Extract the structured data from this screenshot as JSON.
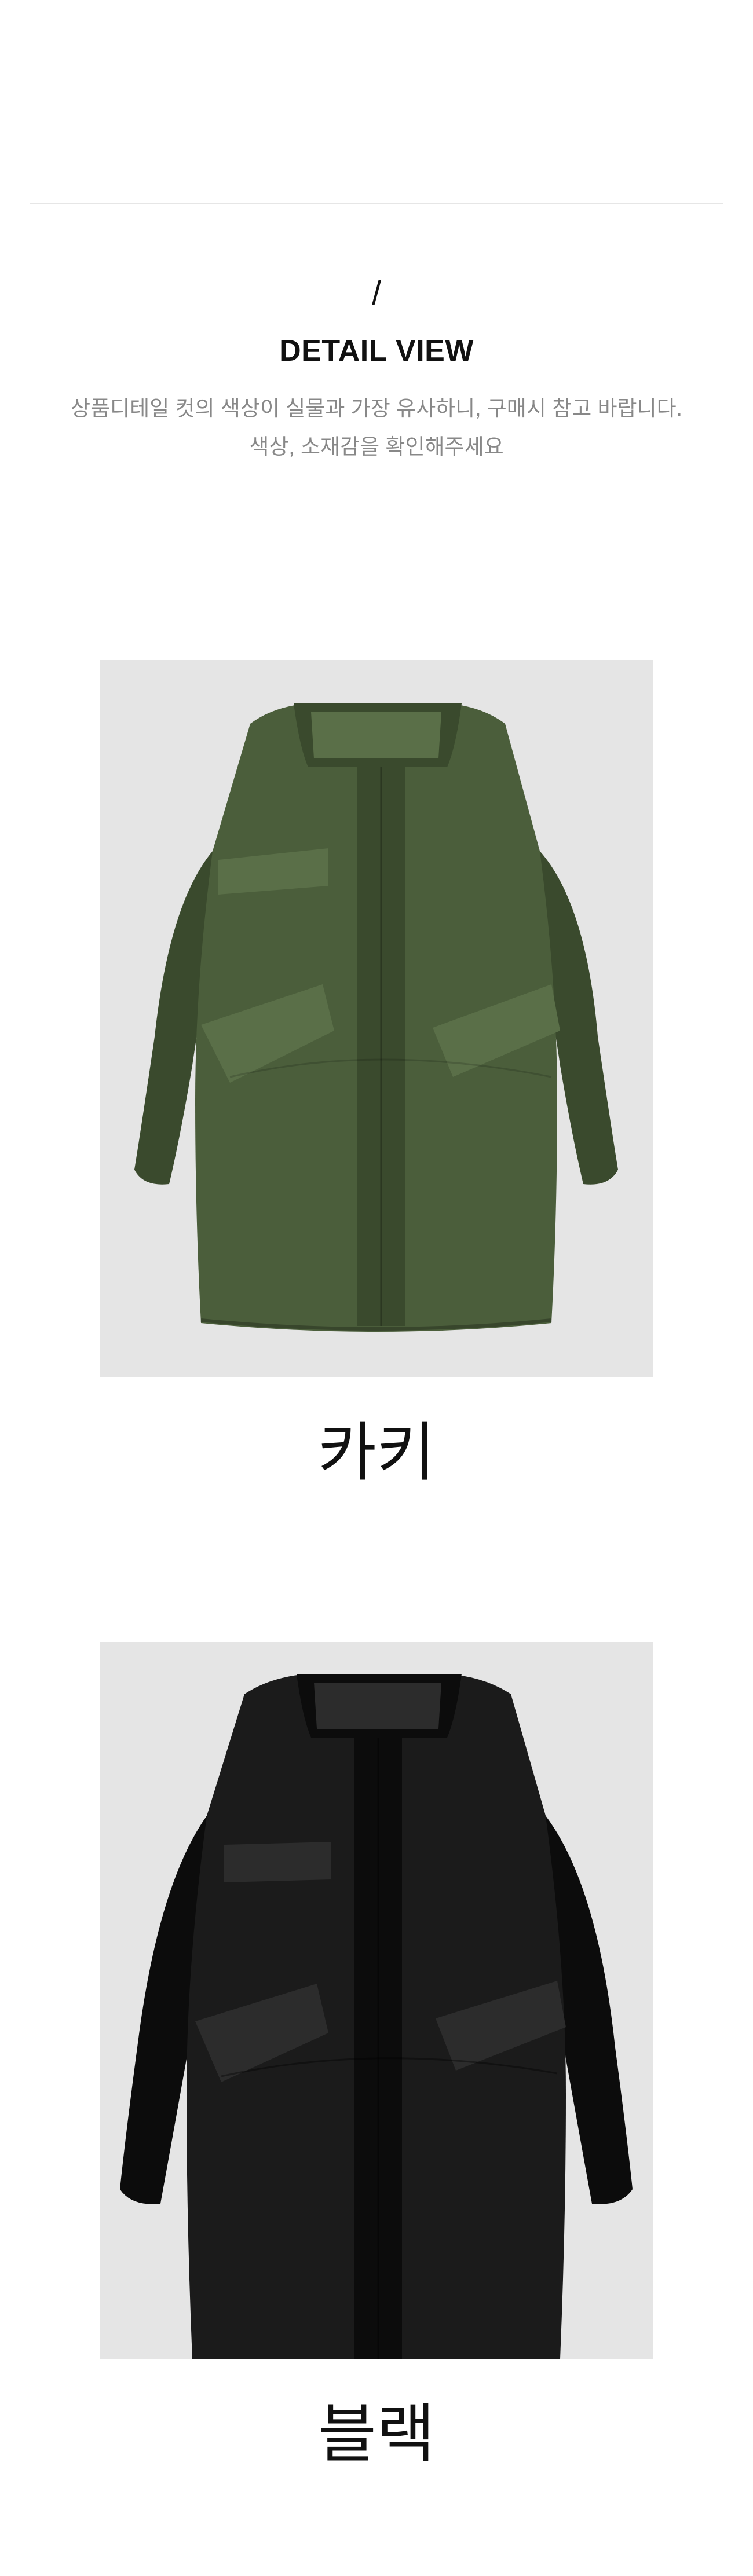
{
  "section": {
    "slash": "/",
    "title": "DETAIL VIEW",
    "description_line1": "상품디테일 컷의 색상이 실물과 가장 유사하니, 구매시 참고 바랍니다.",
    "description_line2": "색상, 소재감을 확인해주세요"
  },
  "products": [
    {
      "color_label": "카키",
      "fill": "#4b5e3b",
      "shade": "#3a4a2d",
      "highlight": "#5a6f48",
      "background": "#e5e5e5"
    },
    {
      "color_label": "블랙",
      "fill": "#1b1b1b",
      "shade": "#0c0c0c",
      "highlight": "#2c2c2c",
      "background": "#e5e5e5"
    }
  ]
}
